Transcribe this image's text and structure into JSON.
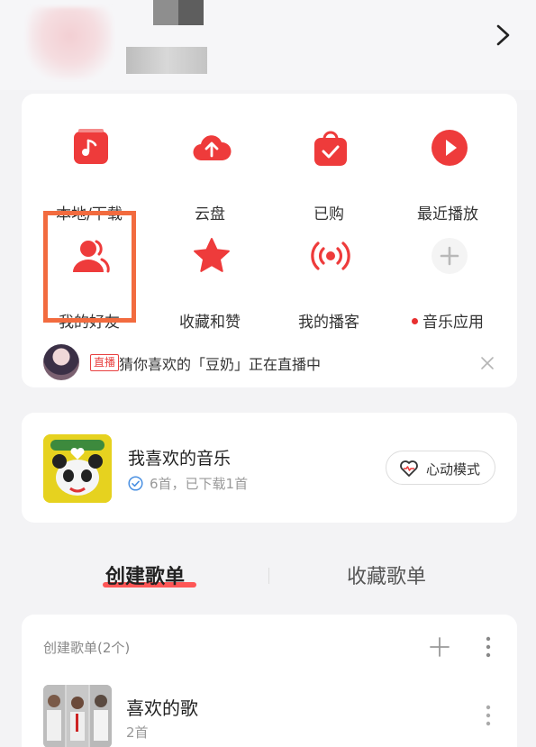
{
  "quick_grid": {
    "items": [
      {
        "label": "本地/下载",
        "icon": "local-download-icon"
      },
      {
        "label": "云盘",
        "icon": "cloud-upload-icon"
      },
      {
        "label": "已购",
        "icon": "purchased-bag-icon"
      },
      {
        "label": "最近播放",
        "icon": "play-circle-icon"
      },
      {
        "label": "我的好友",
        "icon": "friends-icon"
      },
      {
        "label": "收藏和赞",
        "icon": "star-icon"
      },
      {
        "label": "我的播客",
        "icon": "podcast-icon"
      },
      {
        "label": "音乐应用",
        "icon": "plus-icon"
      }
    ]
  },
  "live_bar": {
    "badge": "直播",
    "text": "猜你喜欢的「豆奶」正在直播中"
  },
  "favorite": {
    "title": "我喜欢的音乐",
    "subtitle": "6首，已下载1首",
    "mode_button": "心动模式"
  },
  "tabs": {
    "create": "创建歌单",
    "collect": "收藏歌单"
  },
  "playlists": {
    "header": "创建歌单(2个)",
    "items": [
      {
        "name": "喜欢的歌",
        "count": "2首"
      }
    ]
  },
  "colors": {
    "brand_red": "#ee3b3b",
    "highlight_orange": "#f26b3f"
  }
}
